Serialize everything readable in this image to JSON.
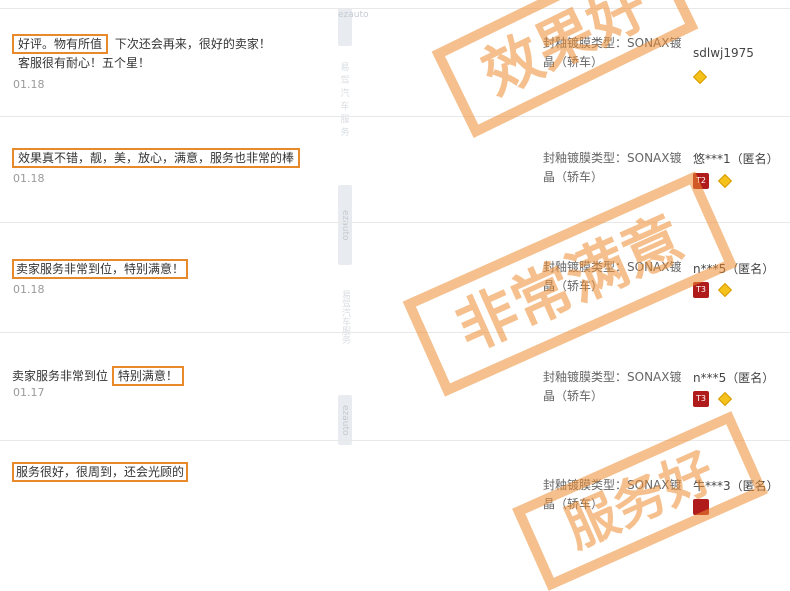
{
  "reviews": [
    {
      "highlight": "好评。物有所值",
      "rest": "下次还会再来，很好的卖家！",
      "line2": "客服很有耐心！五个星！",
      "date": "01.18",
      "sku": "封釉镀膜类型：SONAX镀晶（轿车）",
      "user": "sdlwj1975",
      "level": ""
    },
    {
      "highlight": "效果真不错，靓，美，放心，满意，服务也非常的棒",
      "date": "01.18",
      "sku": "封釉镀膜类型：SONAX镀晶（轿车）",
      "user": "悠***1（匿名）",
      "level": "T2"
    },
    {
      "highlight": "卖家服务非常到位，特别满意！",
      "date": "01.18",
      "sku": "封釉镀膜类型：SONAX镀晶（轿车）",
      "user": "n***5（匿名）",
      "level": "T3"
    },
    {
      "prefix": "卖家服务非常到位",
      "highlight": "特别满意！",
      "date": "01.17",
      "sku": "封釉镀膜类型：SONAX镀晶（轿车）",
      "user": "n***5（匿名）",
      "level": "T3"
    },
    {
      "highlight": "服务很好，很周到，还会光顾的",
      "sku": "封釉镀膜类型：SONAX镀晶（轿车）",
      "user": "牛***3（匿名）"
    }
  ],
  "stamps": [
    "效果好",
    "非常满意",
    "服务好"
  ],
  "watermark": {
    "logo_text": "ezauto",
    "side_text": "易驾汽车服务"
  },
  "colors": {
    "highlight_border": "#e8892b",
    "stamp": "#ec8c32",
    "level_badge": "#b01c1c",
    "diamond": "#f4c21b"
  }
}
